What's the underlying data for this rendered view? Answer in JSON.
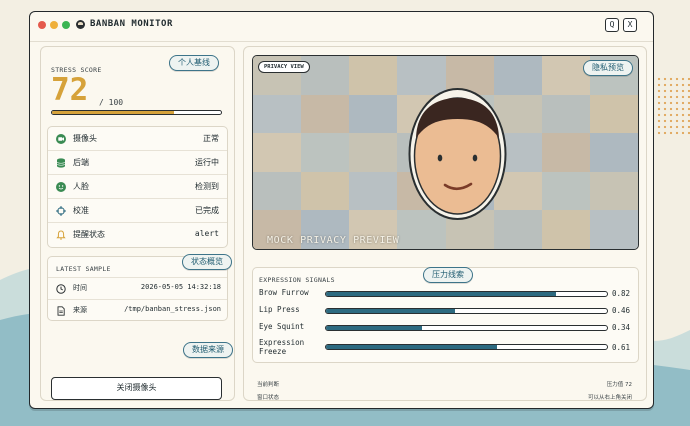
{
  "window": {
    "title": "BANBAN MONITOR",
    "buttons": {
      "q": "Q",
      "x": "X"
    }
  },
  "stress": {
    "label": "STRESS SCORE",
    "score": "72",
    "max": "/ 100",
    "fraction": 0.72,
    "baseline_button": "个人基线"
  },
  "status": [
    {
      "icon": "camera-icon",
      "label": "摄像头",
      "value": "正常"
    },
    {
      "icon": "database-icon",
      "label": "后端",
      "value": "运行中"
    },
    {
      "icon": "face-smile-icon",
      "label": "人脸",
      "value": "检测到"
    },
    {
      "icon": "crosshair-icon",
      "label": "校准",
      "value": "已完成"
    },
    {
      "icon": "bell-icon",
      "label": "提醒状态",
      "value": "alert"
    }
  ],
  "sample": {
    "title": "LATEST SAMPLE",
    "overview_button": "状态概览",
    "rows": [
      {
        "icon": "clock-icon",
        "label": "时间",
        "value": "2026-05-05 14:32:18"
      },
      {
        "icon": "document-icon",
        "label": "来源",
        "value": "/tmp/banban_stress.json"
      }
    ],
    "source_button": "数据来源"
  },
  "close_camera_button": "关闭摄像头",
  "preview": {
    "tag": "PRIVACY VIEW",
    "privacy_button": "隐私预览",
    "caption": "MOCK PRIVACY PREVIEW",
    "tile_colors": [
      "#c7c3b4",
      "#b9bfbd",
      "#cfc3aa",
      "#b8c0c3",
      "#c7b9a6",
      "#aeb9c0",
      "#d2c7b2",
      "#bcc3bf"
    ]
  },
  "expressions": {
    "title": "EXPRESSION SIGNALS",
    "pressure_button": "压力线索",
    "items": [
      {
        "label": "Brow Furrow",
        "value": 0.82,
        "display": "0.82"
      },
      {
        "label": "Lip Press",
        "value": 0.46,
        "display": "0.46"
      },
      {
        "label": "Eye Squint",
        "value": 0.34,
        "display": "0.34"
      },
      {
        "label": "Expression Freeze",
        "value": 0.61,
        "display": "0.61"
      }
    ]
  },
  "footer": {
    "current_label": "当前判断",
    "pressure_value": "压力值 72",
    "window_label": "窗口状态",
    "close_hint": "可以从右上角关闭"
  },
  "colors": {
    "accent_gold": "#d6a23a",
    "accent_teal": "#2d6a80",
    "background": "#f3efe3",
    "wave": "#7fb1bf"
  }
}
